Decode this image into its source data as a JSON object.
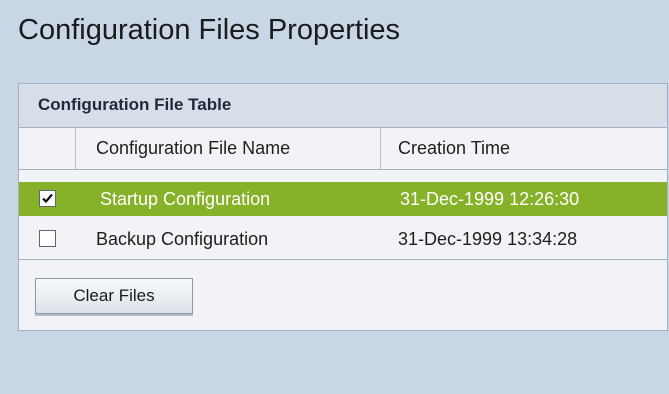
{
  "page": {
    "title": "Configuration Files Properties"
  },
  "table": {
    "title": "Configuration File Table",
    "columns": [
      "Configuration File Name",
      "Creation Time"
    ],
    "rows": [
      {
        "name": "Startup Configuration",
        "time": "31-Dec-1999 12:26:30",
        "checked": true,
        "selected": true
      },
      {
        "name": "Backup Configuration",
        "time": "31-Dec-1999 13:34:28",
        "checked": false,
        "selected": false
      }
    ]
  },
  "actions": {
    "clear_files_label": "Clear Files"
  },
  "colors": {
    "page_background": "#c8d6e6",
    "panel_background": "#f1f3f7",
    "header_background": "#d7dee8",
    "selected_row": "#86b22a",
    "border": "#a3b1c2"
  },
  "icons": {
    "checkmark": "check-icon"
  }
}
